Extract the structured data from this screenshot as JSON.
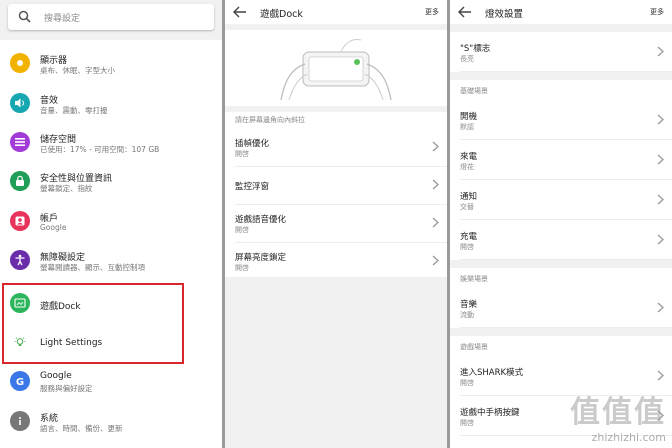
{
  "settings": {
    "search_placeholder": "搜尋設定",
    "items": [
      {
        "title": "顯示器",
        "subtitle": "桌布、休眠、字型大小",
        "icon": "brightness-icon",
        "color": "#f2b200"
      },
      {
        "title": "音效",
        "subtitle": "音量、震動、零打擾",
        "icon": "volume-icon",
        "color": "#16a7b0"
      },
      {
        "title": "儲存空間",
        "subtitle": "已使用：17% - 可用空間：107 GB",
        "icon": "storage-icon",
        "color": "#a23bd8"
      },
      {
        "title": "安全性與位置資訊",
        "subtitle": "螢幕鎖定、指紋",
        "icon": "lock-icon",
        "color": "#1f9e57"
      },
      {
        "title": "帳戶",
        "subtitle": "Google",
        "icon": "account-icon",
        "color": "#e8335a"
      },
      {
        "title": "無障礙設定",
        "subtitle": "螢幕閱讀器、顯示、互動控制項",
        "icon": "accessibility-icon",
        "color": "#6a2ca8"
      },
      {
        "title": "遊戲Dock",
        "subtitle": "",
        "icon": "game-dock-icon",
        "color": "#2db55d"
      },
      {
        "title": "Light Settings",
        "subtitle": "",
        "icon": "lightbulb-icon",
        "color": "#ffffff"
      },
      {
        "title": "Google",
        "subtitle": "服務與偏好設定",
        "icon": "google-icon",
        "color": "#3b78e7"
      },
      {
        "title": "系統",
        "subtitle": "語言、時間、備份、更新",
        "icon": "info-icon",
        "color": "#777777"
      }
    ]
  },
  "dock": {
    "title": "遊戲Dock",
    "more": "更多",
    "hint": "請在屏幕邊角向內斜拉",
    "rows": [
      {
        "title": "插幀優化",
        "subtitle": "開啓"
      },
      {
        "title": "監控浮窗",
        "subtitle": ""
      },
      {
        "title": "遊戲語音優化",
        "subtitle": "開啓"
      },
      {
        "title": "屏幕亮度鎖定",
        "subtitle": "開啓"
      }
    ]
  },
  "light": {
    "title": "燈效設置",
    "more": "更多",
    "top_row": {
      "title": "\"S\"標志",
      "subtitle": "長亮"
    },
    "sections": [
      {
        "header": "基礎場景",
        "rows": [
          {
            "title": "開機",
            "subtitle": "默認"
          },
          {
            "title": "來電",
            "subtitle": "燈花"
          },
          {
            "title": "通知",
            "subtitle": "交替"
          },
          {
            "title": "充電",
            "subtitle": "開啓"
          }
        ]
      },
      {
        "header": "娛樂場景",
        "rows": [
          {
            "title": "音樂",
            "subtitle": "流動"
          }
        ]
      },
      {
        "header": "遊戲場景",
        "rows": [
          {
            "title": "進入SHARK模式",
            "subtitle": "開啓"
          },
          {
            "title": "遊戲中手柄按鍵",
            "subtitle": "開啓"
          }
        ]
      }
    ]
  },
  "watermark": {
    "logo": "值值值",
    "url": "zhizhizhi.com"
  }
}
